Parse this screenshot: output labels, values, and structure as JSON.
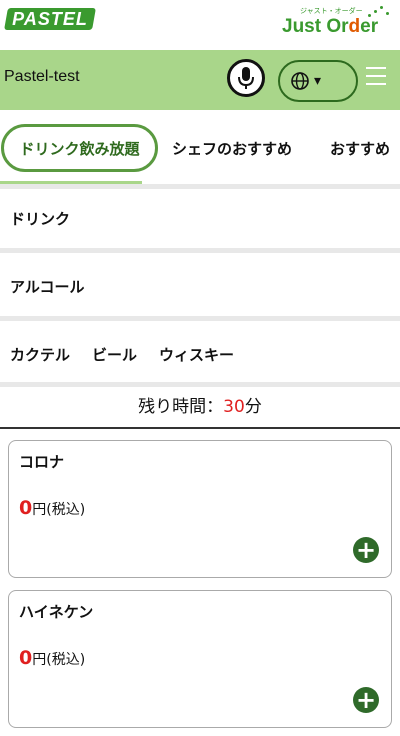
{
  "topbar": {
    "logo_left": "PASTEL",
    "logo_right_small": "ジャスト・オーダー",
    "logo_right_main_a": "Just Or",
    "logo_right_main_b": "d",
    "logo_right_main_c": "er"
  },
  "header": {
    "shop_name": "Pastel-test",
    "lang_icon": "globe-icon",
    "lang_caret": "▾"
  },
  "tabs": [
    {
      "label": "ドリンク飲み放題"
    },
    {
      "label": "シェフのおすすめ"
    },
    {
      "label": "おすすめ"
    }
  ],
  "categories": [
    {
      "label": "ドリンク"
    },
    {
      "label": "アルコール"
    }
  ],
  "subcategories": [
    {
      "label": "カクテル"
    },
    {
      "label": "ビール"
    },
    {
      "label": "ウィスキー"
    }
  ],
  "timer": {
    "label": "残り時間：",
    "value": "30",
    "unit": "分"
  },
  "items": [
    {
      "name": "コロナ",
      "price": "0",
      "price_suffix": "円(税込)"
    },
    {
      "name": "ハイネケン",
      "price": "0",
      "price_suffix": "円(税込)"
    }
  ],
  "colors": {
    "header_bg": "#a9d68a",
    "accent_green": "#3a9a2f",
    "price_red": "#e02020"
  }
}
